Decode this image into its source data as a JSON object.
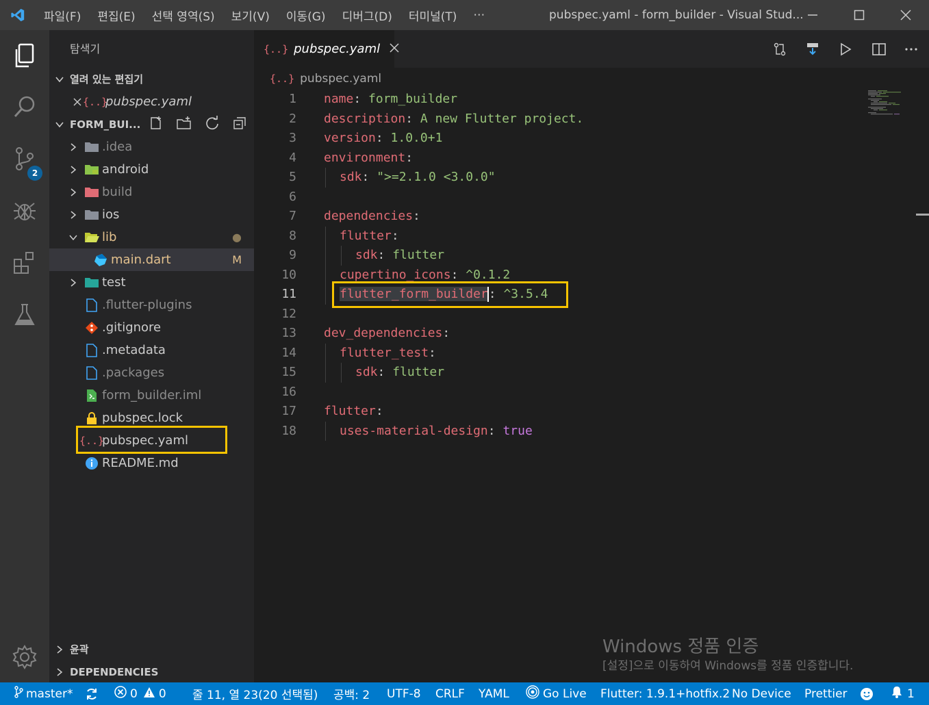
{
  "window": {
    "menu": [
      "파일(F)",
      "편집(E)",
      "선택 영역(S)",
      "보기(V)",
      "이동(G)",
      "디버그(D)",
      "터미널(T)",
      "⋯"
    ],
    "title": "pubspec.yaml - form_builder - Visual Stud..."
  },
  "activity_bar": {
    "scm_badge": "2"
  },
  "sidebar": {
    "title": "탐색기",
    "open_editors_label": "열려 있는 편집기",
    "open_editors": [
      {
        "icon": "{..}",
        "name": "pubspec.yaml"
      }
    ],
    "folder_label": "FORM_BUI...",
    "tree": [
      {
        "name": ".idea",
        "type": "folder"
      },
      {
        "name": "android",
        "type": "folder"
      },
      {
        "name": "build",
        "type": "folder"
      },
      {
        "name": "ios",
        "type": "folder"
      },
      {
        "name": "lib",
        "type": "folder-open",
        "decoration": "●"
      },
      {
        "name": "main.dart",
        "type": "dart",
        "decoration": "M"
      },
      {
        "name": "test",
        "type": "folder"
      },
      {
        "name": ".flutter-plugins",
        "type": "file"
      },
      {
        "name": ".gitignore",
        "type": "git"
      },
      {
        "name": ".metadata",
        "type": "file"
      },
      {
        "name": ".packages",
        "type": "file"
      },
      {
        "name": "form_builder.iml",
        "type": "iml"
      },
      {
        "name": "pubspec.lock",
        "type": "lock"
      },
      {
        "name": "pubspec.yaml",
        "type": "yaml"
      },
      {
        "name": "README.md",
        "type": "info"
      }
    ],
    "outline_label": "윤곽",
    "dependencies_label": "DEPENDENCIES"
  },
  "editor": {
    "tab_icon": "{..}",
    "tab_label": "pubspec.yaml",
    "breadcrumb": "pubspec.yaml",
    "lines": [
      {
        "num": "1",
        "key": "name",
        "value": "form_builder"
      },
      {
        "num": "2",
        "key": "description",
        "value": "A new Flutter project."
      },
      {
        "num": "3",
        "key": "version",
        "value": "1.0.0+1"
      },
      {
        "num": "4",
        "key": "environment",
        "value": ""
      },
      {
        "num": "5",
        "key": "sdk",
        "value": "\">=2.1.0 <3.0.0\""
      },
      {
        "num": "6",
        "key": "",
        "value": ""
      },
      {
        "num": "7",
        "key": "dependencies",
        "value": ""
      },
      {
        "num": "8",
        "key": "flutter",
        "value": ""
      },
      {
        "num": "9",
        "key": "sdk",
        "value": "flutter"
      },
      {
        "num": "10",
        "key": "cupertino_icons",
        "value": "^0.1.2"
      },
      {
        "num": "11",
        "key": "flutter_form_builder",
        "value": "^3.5.4"
      },
      {
        "num": "12",
        "key": "",
        "value": ""
      },
      {
        "num": "13",
        "key": "dev_dependencies",
        "value": ""
      },
      {
        "num": "14",
        "key": "flutter_test",
        "value": ""
      },
      {
        "num": "15",
        "key": "sdk",
        "value": "flutter"
      },
      {
        "num": "16",
        "key": "",
        "value": ""
      },
      {
        "num": "17",
        "key": "flutter",
        "value": ""
      },
      {
        "num": "18",
        "key": "uses-material-design",
        "value": "true"
      }
    ]
  },
  "watermark": {
    "line1": "Windows 정품 인증",
    "line2": "[설정]으로 이동하여 Windows를 정품 인증합니다."
  },
  "statusbar": {
    "branch": "master*",
    "errors": "0",
    "warnings": "0",
    "cursor": "줄 11, 열 23(20 선택됨)",
    "spaces": "공백: 2",
    "encoding": "UTF-8",
    "eol": "CRLF",
    "language": "YAML",
    "golive": "Go Live",
    "flutter": "Flutter: 1.9.1+hotfix.2",
    "device": "No Device",
    "prettier": "Prettier",
    "notifications": "1"
  },
  "colors": {
    "accent": "#007acc",
    "highlight_box": "#f7c300",
    "yaml_key": "#e06c75",
    "yaml_value": "#98c379"
  }
}
